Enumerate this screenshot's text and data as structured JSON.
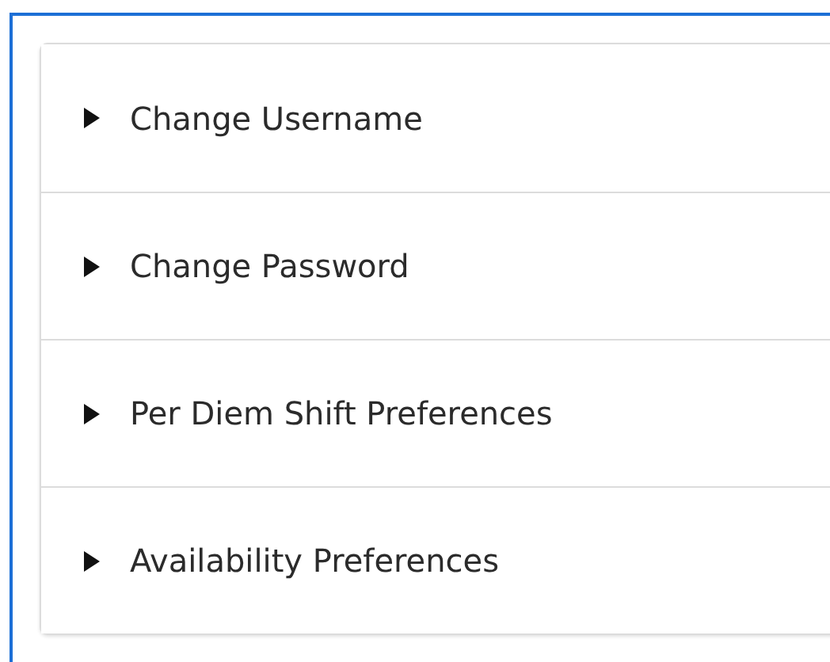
{
  "accordion": [
    {
      "label": "Change Username",
      "expanded": false
    },
    {
      "label": "Change Password",
      "expanded": false
    },
    {
      "label": "Per Diem Shift Preferences",
      "expanded": false
    },
    {
      "label": "Availability Preferences",
      "expanded": false
    }
  ]
}
